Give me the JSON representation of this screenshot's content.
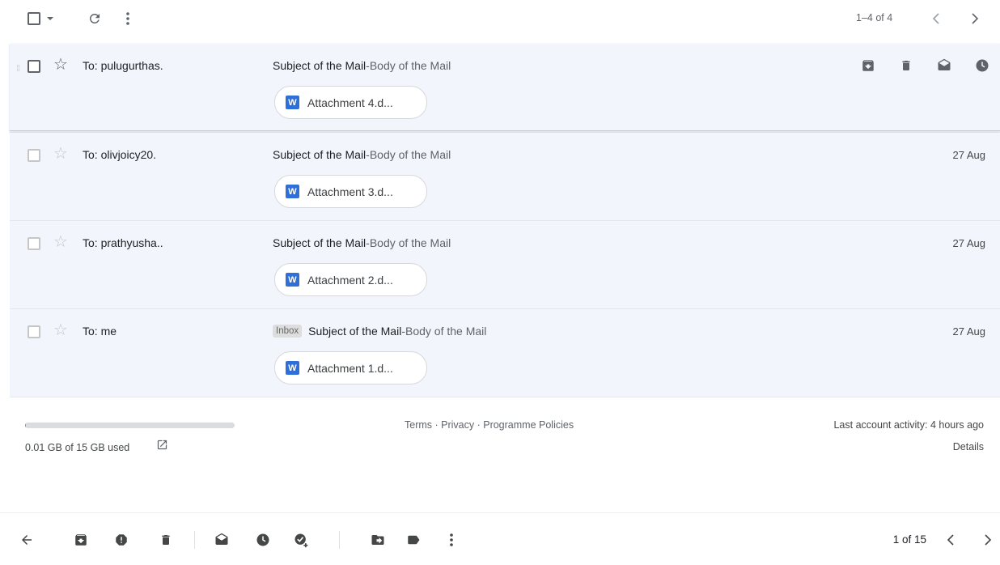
{
  "toolbar": {
    "pagination": "1–4 of 4"
  },
  "threads": [
    {
      "recipient": "To: pulugurthas.",
      "tag": "",
      "subject": "Subject of the Mail",
      "separator": " - ",
      "snippet": "Body of the Mail",
      "attachment": "Attachment 4.d...",
      "attachment_icon_letter": "W",
      "date": "",
      "hovered": true
    },
    {
      "recipient": "To: olivjoicy20.",
      "tag": "",
      "subject": "Subject of the Mail",
      "separator": " - ",
      "snippet": "Body of the Mail",
      "attachment": "Attachment 3.d...",
      "attachment_icon_letter": "W",
      "date": "27 Aug",
      "hovered": false
    },
    {
      "recipient": "To: prathyusha..",
      "tag": "",
      "subject": "Subject of the Mail",
      "separator": " - ",
      "snippet": "Body of the Mail",
      "attachment": "Attachment 2.d...",
      "attachment_icon_letter": "W",
      "date": "27 Aug",
      "hovered": false
    },
    {
      "recipient": "To: me",
      "tag": "Inbox",
      "subject": "Subject of the Mail",
      "separator": " - ",
      "snippet": "Body of the Mail",
      "attachment": "Attachment 1.d...",
      "attachment_icon_letter": "W",
      "date": "27 Aug",
      "hovered": false
    }
  ],
  "footer": {
    "storage_text": "0.01 GB of 15 GB used",
    "storage_used_fraction": 0.001,
    "terms": "Terms",
    "privacy": "Privacy",
    "policies": "Programme Policies",
    "link_sep": " · ",
    "last_activity": "Last account activity: 4 hours ago",
    "details": "Details"
  },
  "bottombar": {
    "page_count": "1 of 15"
  },
  "colors": {
    "row_bg": "#f2f6fc",
    "word_blue": "#2f6fd8",
    "icon_gray": "#5f6368"
  }
}
